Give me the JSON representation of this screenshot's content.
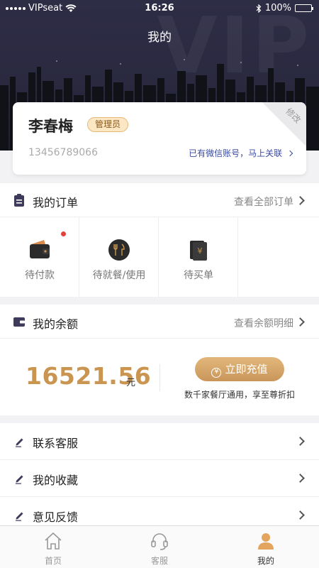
{
  "status_bar": {
    "carrier": "VIPseat",
    "time": "16:26",
    "battery": "100%"
  },
  "header": {
    "title": "我的",
    "watermark": "VIP"
  },
  "profile": {
    "name": "李春梅",
    "role": "管理员",
    "phone": "13456789066",
    "wechat_link": "已有微信账号，马上关联",
    "edit_label": "修改"
  },
  "orders": {
    "title": "我的订单",
    "view_all": "查看全部订单",
    "items": [
      {
        "label": "待付款",
        "icon": "wallet-icon",
        "has_badge": true
      },
      {
        "label": "待就餐/使用",
        "icon": "dining-icon",
        "has_badge": false
      },
      {
        "label": "待买单",
        "icon": "bill-icon",
        "has_badge": false
      }
    ]
  },
  "balance": {
    "title": "我的余额",
    "view_detail": "查看余额明细",
    "amount": "16521.56",
    "unit": "元",
    "recharge_label": "立即充值",
    "recharge_icon": "¥",
    "note": "数千家餐厅通用，享至尊折扣"
  },
  "menu": [
    {
      "label": "联系客服"
    },
    {
      "label": "我的收藏"
    },
    {
      "label": "意见反馈"
    }
  ],
  "tabs": [
    {
      "label": "首页",
      "icon": "home-icon"
    },
    {
      "label": "客服",
      "icon": "headset-icon"
    },
    {
      "label": "我的",
      "icon": "user-icon",
      "active": true
    }
  ],
  "colors": {
    "header_bg": "#2a2940",
    "accent_gold": "#c99550",
    "badge_red": "#e3413a",
    "link_blue": "#3b4aa0"
  }
}
